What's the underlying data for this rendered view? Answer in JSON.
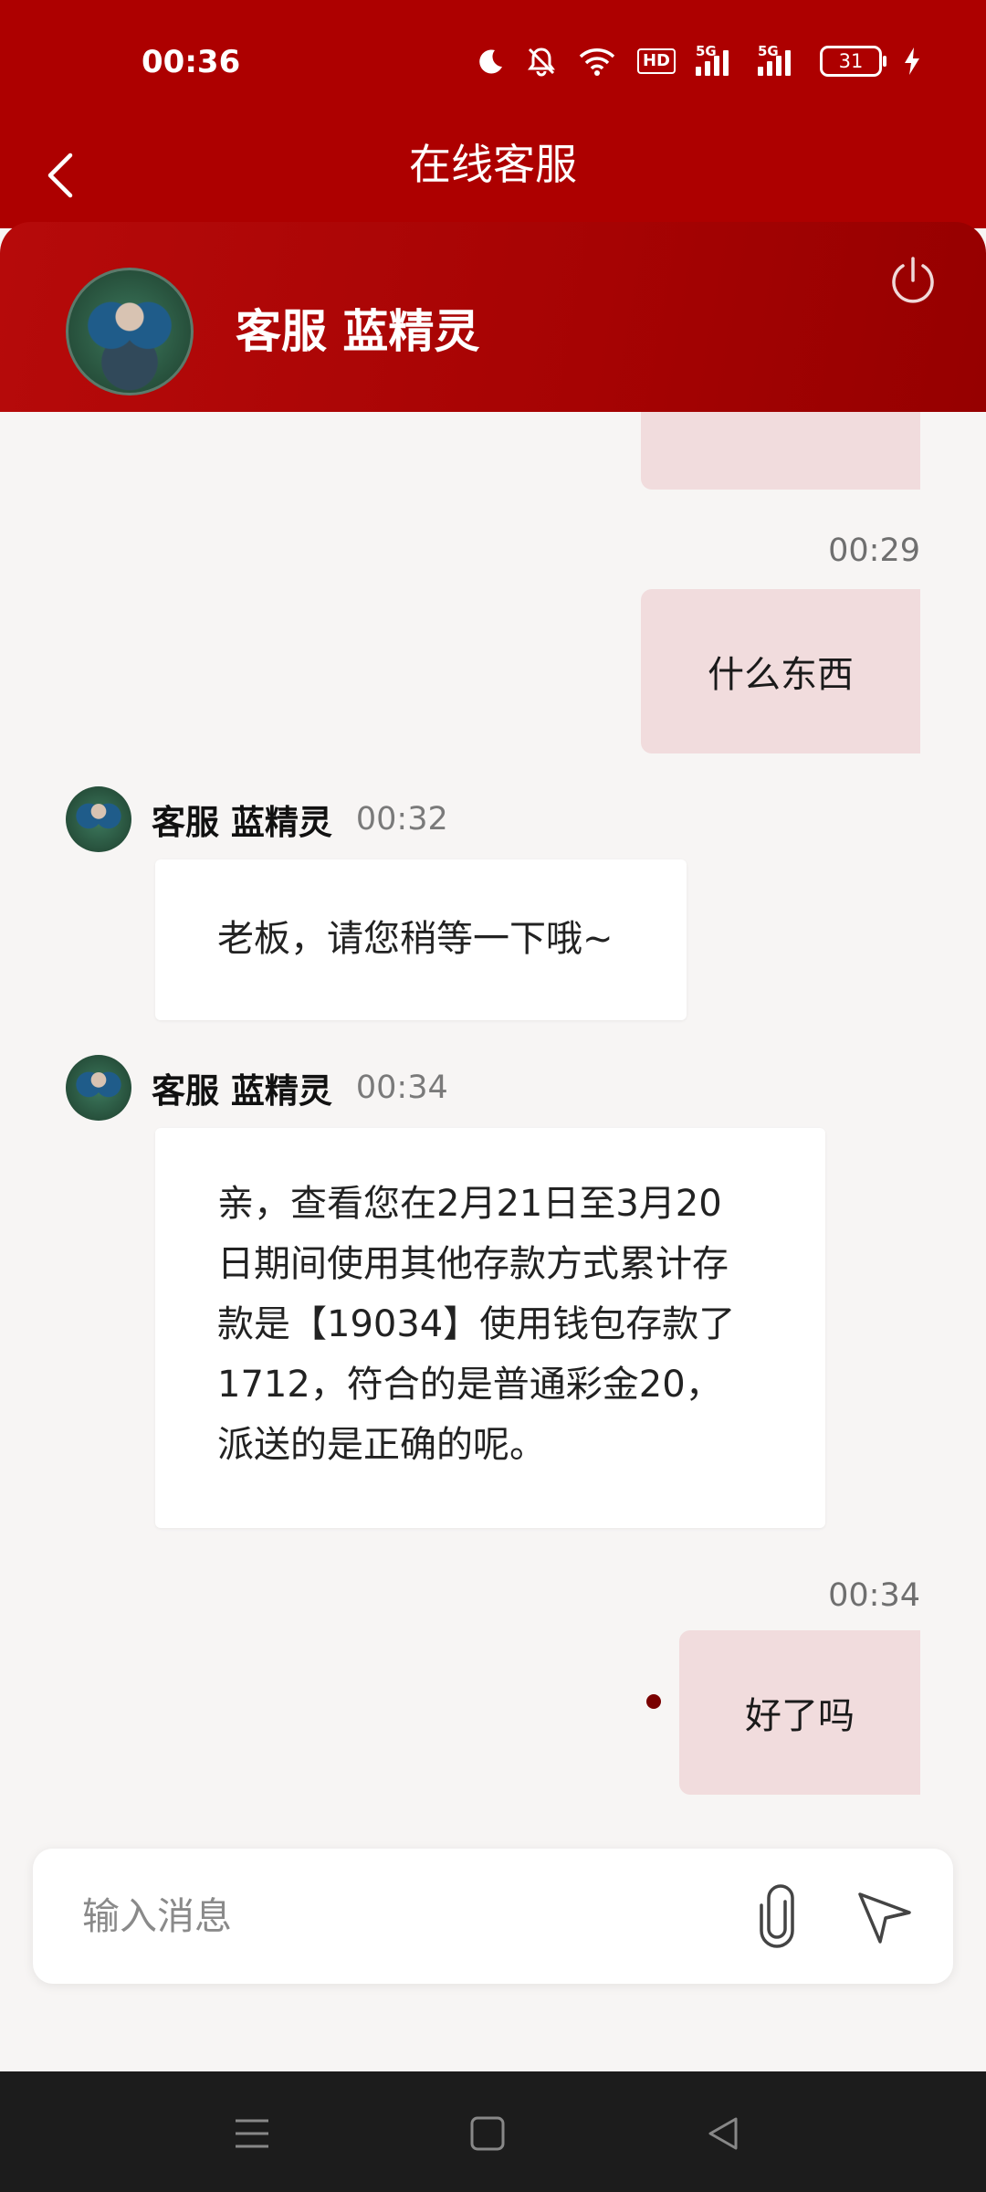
{
  "status_bar": {
    "time": "00:36",
    "hd_label": "HD",
    "signal_1_label": "5G",
    "signal_2_label": "5G",
    "battery": "31",
    "icons": [
      "moon-icon",
      "silent-bell-icon",
      "wifi-icon",
      "hd-icon",
      "signal-icon",
      "signal-icon",
      "battery-icon",
      "charging-icon"
    ]
  },
  "header": {
    "title": "在线客服"
  },
  "agent": {
    "name": "客服 蓝精灵"
  },
  "messages": {
    "m1": {
      "time": "00:29",
      "text": "什么东西"
    },
    "m2": {
      "sender": "客服 蓝精灵",
      "time": "00:32",
      "text": "老板，请您稍等一下哦~"
    },
    "m3": {
      "sender": "客服 蓝精灵",
      "time": "00:34",
      "lines": [
        "亲，查看您在2月21日至3月20",
        "日期间使用其他存款方式累计存",
        "款是【19034】使用钱包存款了",
        "1712，符合的是普通彩金20，",
        "派送的是正确的呢。"
      ]
    },
    "m4": {
      "time": "00:34",
      "text": "好了吗"
    }
  },
  "composer": {
    "placeholder": "输入消息"
  },
  "colors": {
    "brand": "#ad0000",
    "outgoing_bubble": "#f1dcdd",
    "incoming_bubble": "#ffffff",
    "background": "#f7f5f4"
  }
}
